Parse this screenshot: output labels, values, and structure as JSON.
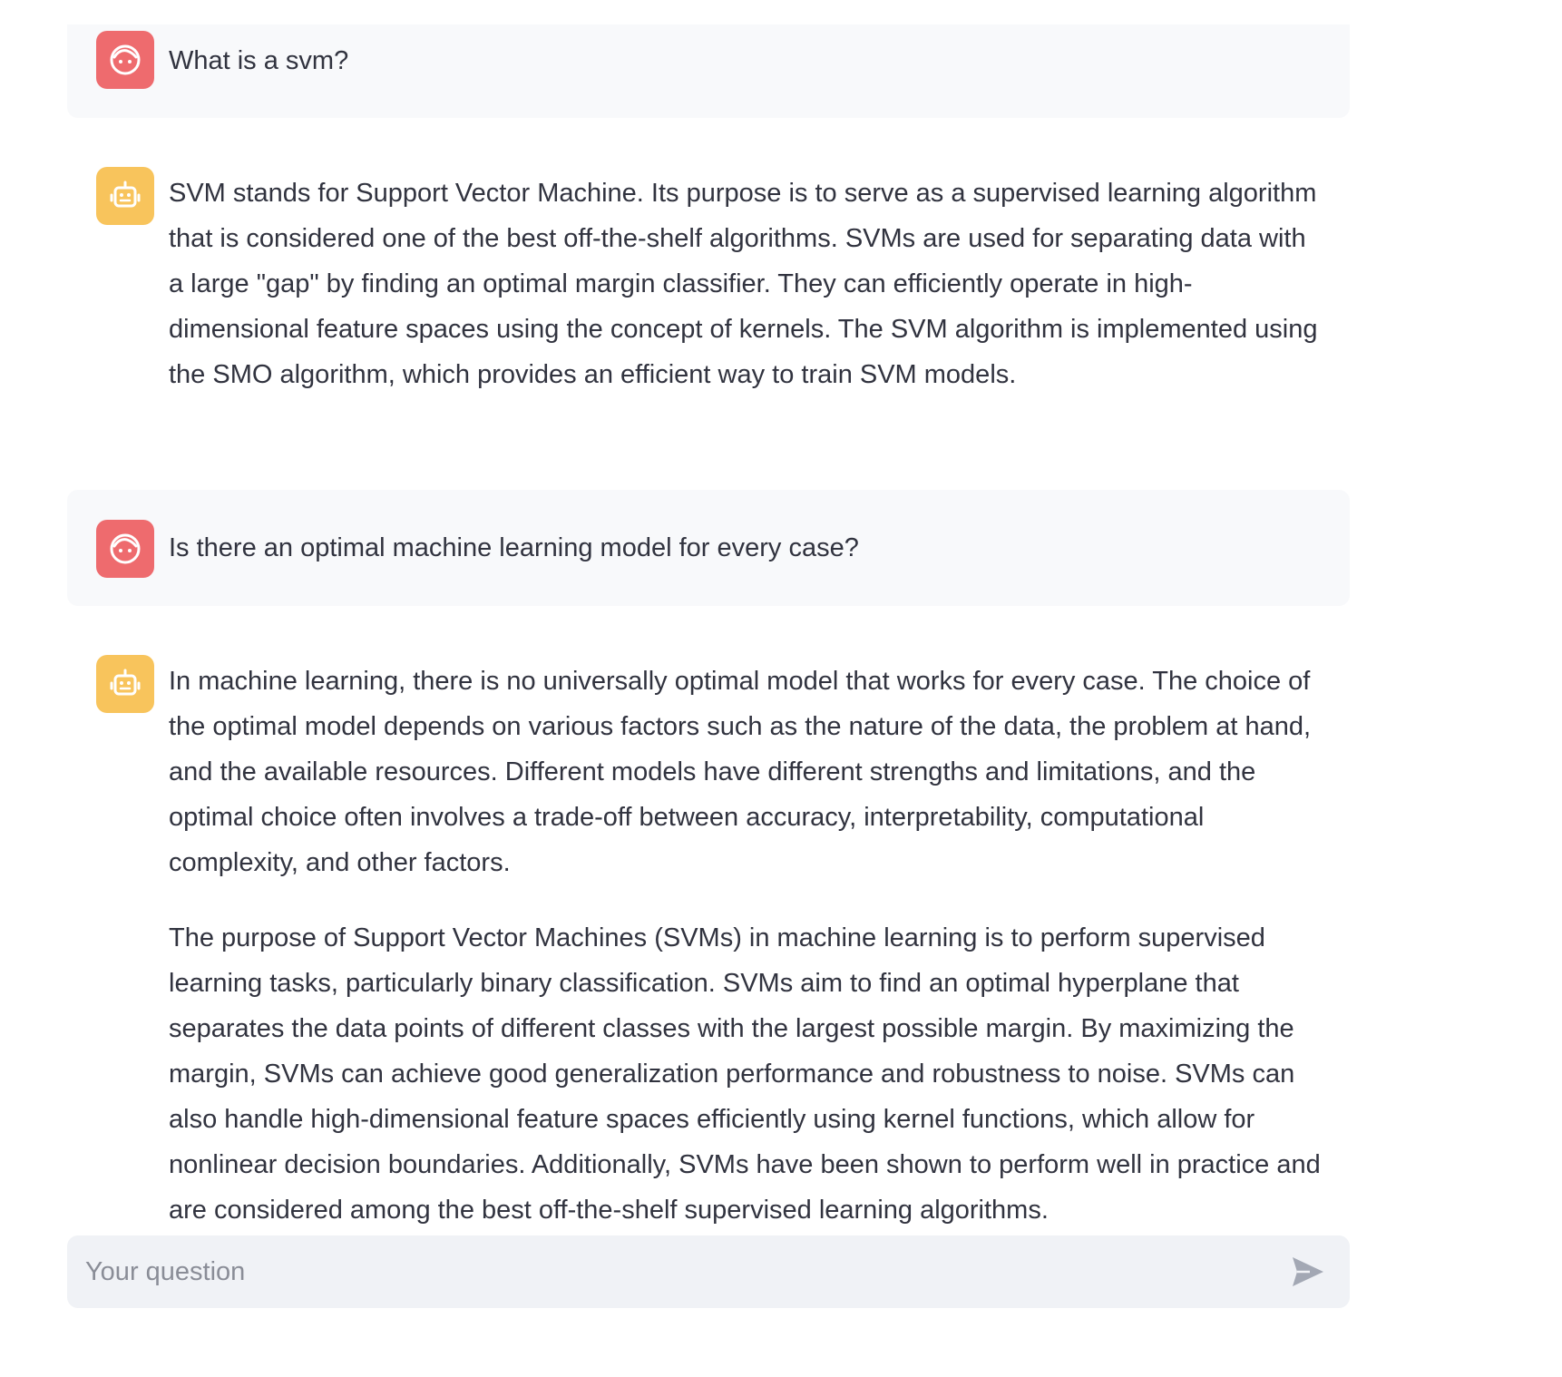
{
  "conversation": {
    "messages": [
      {
        "role": "user",
        "avatar_icon": "user-face-icon",
        "paragraphs": [
          "What is a svm?"
        ]
      },
      {
        "role": "assistant",
        "avatar_icon": "robot-icon",
        "paragraphs": [
          "SVM stands for Support Vector Machine. Its purpose is to serve as a supervised learning algorithm that is considered one of the best off-the-shelf algorithms. SVMs are used for separating data with a large \"gap\" by finding an optimal margin classifier. They can efficiently operate in high-dimensional feature spaces using the concept of kernels. The SVM algorithm is implemented using the SMO algorithm, which provides an efficient way to train SVM models."
        ]
      },
      {
        "role": "user",
        "avatar_icon": "user-face-icon",
        "paragraphs": [
          "Is there an optimal machine learning model for every case?"
        ]
      },
      {
        "role": "assistant",
        "avatar_icon": "robot-icon",
        "paragraphs": [
          "In machine learning, there is no universally optimal model that works for every case. The choice of the optimal model depends on various factors such as the nature of the data, the problem at hand, and the available resources. Different models have different strengths and limitations, and the optimal choice often involves a trade-off between accuracy, interpretability, computational complexity, and other factors.",
          "The purpose of Support Vector Machines (SVMs) in machine learning is to perform supervised learning tasks, particularly binary classification. SVMs aim to find an optimal hyperplane that separates the data points of different classes with the largest possible margin. By maximizing the margin, SVMs can achieve good generalization performance and robustness to noise. SVMs can also handle high-dimensional feature spaces efficiently using kernel functions, which allow for nonlinear decision boundaries. Additionally, SVMs have been shown to perform well in practice and are considered among the best off-the-shelf supervised learning algorithms."
        ]
      }
    ]
  },
  "chat_input": {
    "placeholder": "Your question",
    "value": "",
    "send_icon": "send-icon"
  },
  "colors": {
    "user_avatar": "#ee6b6e",
    "assistant_avatar": "#f8c45c",
    "user_bubble": "#f8f9fb",
    "input_background": "#f0f2f6",
    "text": "#31333f",
    "placeholder": "#8a8d97",
    "send_icon": "#a3a8b4"
  }
}
